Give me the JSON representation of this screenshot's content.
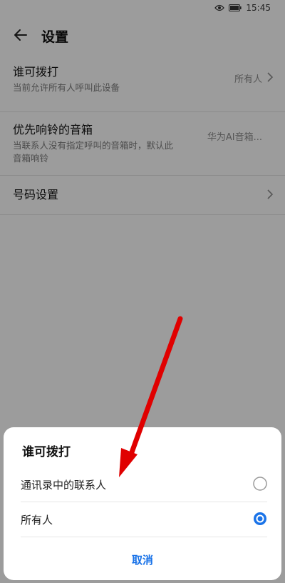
{
  "status_bar": {
    "time": "15:45"
  },
  "header": {
    "title": "设置"
  },
  "settings": [
    {
      "title": "谁可拨打",
      "subtitle": "当前允许所有人呼叫此设备",
      "value": "所有人"
    },
    {
      "title": "优先响铃的音箱",
      "subtitle": "当联系人没有指定呼叫的音箱时，默认此音箱响铃",
      "value": "华为AI音箱..."
    },
    {
      "title": "号码设置"
    }
  ],
  "dialog": {
    "title": "谁可拨打",
    "options": [
      {
        "label": "通讯录中的联系人",
        "selected": false
      },
      {
        "label": "所有人",
        "selected": true
      }
    ],
    "cancel_label": "取消"
  },
  "colors": {
    "accent": "#1a73e8",
    "annotation_arrow": "#e00000"
  },
  "icons": [
    "eye-icon",
    "battery-icon",
    "back-arrow-icon",
    "chevron-right-icon",
    "radio-unchecked-icon",
    "radio-checked-icon"
  ]
}
